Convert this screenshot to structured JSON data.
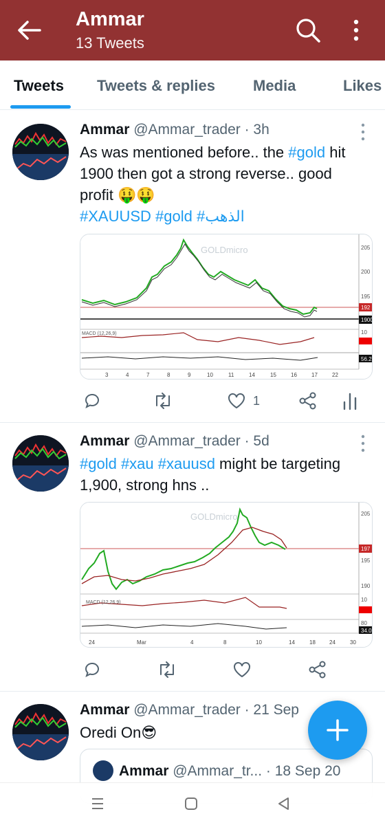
{
  "header": {
    "title": "Ammar",
    "subtitle": "13 Tweets",
    "bg_color": "#923232"
  },
  "tabs": [
    {
      "label": "Tweets",
      "active": true
    },
    {
      "label": "Tweets & replies",
      "active": false
    },
    {
      "label": "Media",
      "active": false
    },
    {
      "label": "Likes",
      "active": false
    }
  ],
  "tweets": [
    {
      "name": "Ammar",
      "handle": "@Ammar_trader",
      "time": "· 3h",
      "text_part1": "As was mentioned before.. the ",
      "text_tag1": "#gold",
      "text_part2": " hit 1900 then got a strong reverse.. good profit 🤑🤑",
      "tags_line": "#XAUUSD #gold #الذهب",
      "chart": {
        "watermark": "GOLDmicro",
        "price_labels": [
          "205",
          "200",
          "195",
          "192",
          "1900"
        ],
        "macd_label": "MACD (12,26,9)",
        "macd_values": [
          "10",
          "56.2"
        ],
        "x_ticks": [
          "3",
          "4",
          "7",
          "8",
          "9",
          "10",
          "11",
          "14",
          "15",
          "16",
          "17",
          "22"
        ]
      },
      "likes": "1"
    },
    {
      "name": "Ammar",
      "handle": "@Ammar_trader",
      "time": "· 5d",
      "text_tags": "#gold #xau #xauusd",
      "text_rest": " might be targeting 1,900, strong hns ..",
      "chart": {
        "watermark": "GOLDmicro",
        "price_labels": [
          "205",
          "197",
          "195",
          "190"
        ],
        "macd_label": "MACD (12,26,9)",
        "macd_values": [
          "10",
          "80",
          "34.0"
        ],
        "x_ticks": [
          "24",
          "Mar",
          "4",
          "8",
          "10",
          "14",
          "18",
          "24",
          "30"
        ]
      }
    },
    {
      "name": "Ammar",
      "handle": "@Ammar_trader",
      "time": "· 21 Sep",
      "text": "Oredi On😎",
      "quote": {
        "name": "Ammar",
        "handle": "@Ammar_tr...",
        "time": "· 18 Sep 20"
      }
    }
  ],
  "colors": {
    "accent": "#1d9bf0",
    "muted": "#536471"
  }
}
